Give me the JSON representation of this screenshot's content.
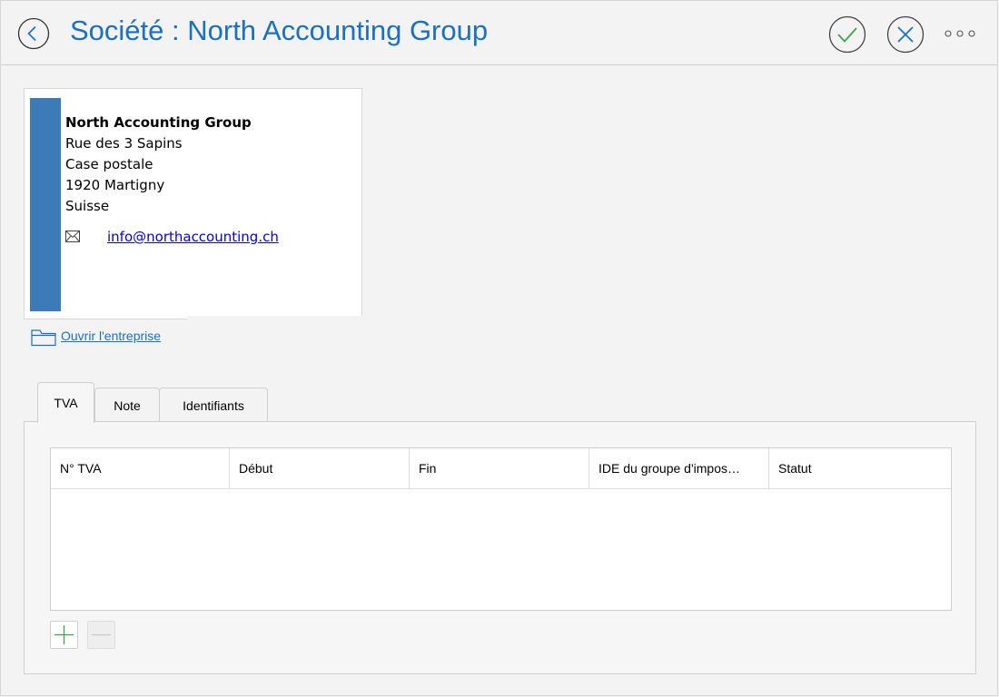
{
  "header": {
    "title": "Société : North Accounting Group",
    "icons": {
      "back": "chevron-left-circle-icon",
      "ok": "checkmark-circle-icon",
      "cancel": "x-circle-icon",
      "more": "more-dots-icon"
    },
    "colors": {
      "title": "#1b6fc4",
      "ok": "#3fa34d",
      "cancel": "#1b6fc4"
    }
  },
  "company_card": {
    "name": "North Accounting Group",
    "address_lines": [
      "Rue des 3 Sapins",
      "Case postale",
      "1920 Martigny",
      "Suisse"
    ],
    "email": "info@northaccounting.ch",
    "email_icon": "envelope-icon",
    "accent_color": "#3d7bb8"
  },
  "open_company": {
    "label": "Ouvrir l'entreprise",
    "icon": "folder-icon"
  },
  "tabs": [
    {
      "label": "TVA",
      "active": true
    },
    {
      "label": "Note",
      "active": false
    },
    {
      "label": "Identifiants",
      "active": false
    }
  ],
  "vat_table": {
    "columns": [
      "N° TVA",
      "Début",
      "Fin",
      "IDE du groupe d'impos…",
      "Statut"
    ],
    "rows": []
  },
  "table_actions": {
    "add_icon": "plus-icon",
    "remove_icon": "minus-icon"
  }
}
